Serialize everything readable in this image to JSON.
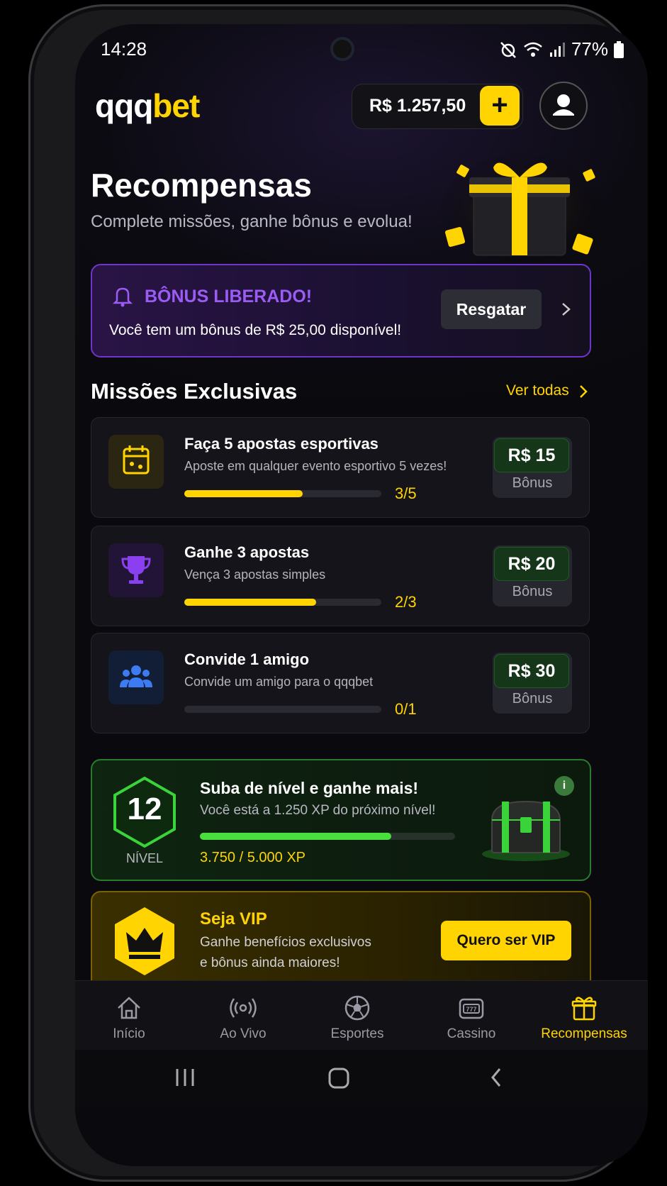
{
  "status": {
    "time": "14:28",
    "battery": "77%"
  },
  "header": {
    "logo_a": "qqq",
    "logo_b": "bet",
    "balance": "R$ 1.257,50",
    "add": "+"
  },
  "page": {
    "title": "Recompensas",
    "subtitle": "Complete missões, ganhe bônus e evolua!"
  },
  "bonus": {
    "title": "BÔNUS LIBERADO!",
    "text": "Você tem um bônus de R$ 25,00 disponível!",
    "button": "Resgatar"
  },
  "missions": {
    "title": "Missões Exclusivas",
    "see_all": "Ver todas",
    "items": [
      {
        "title": "Faça 5 apostas esportivas",
        "desc": "Aposte em qualquer evento esportivo 5 vezes!",
        "progress": "3/5",
        "fraction": 0.6,
        "reward": "R$ 15",
        "reward_label": "Bônus"
      },
      {
        "title": "Ganhe 3 apostas",
        "desc": "Vença 3 apostas simples",
        "progress": "2/3",
        "fraction": 0.67,
        "reward": "R$ 20",
        "reward_label": "Bônus"
      },
      {
        "title": "Convide 1 amigo",
        "desc": "Convide um amigo para o qqqbet",
        "progress": "0/1",
        "fraction": 0,
        "reward": "R$ 30",
        "reward_label": "Bônus"
      }
    ]
  },
  "level": {
    "number": "12",
    "label": "NÍVEL",
    "title": "Suba de nível e ganhe mais!",
    "desc": "Você está a 1.250 XP do próximo nível!",
    "xp": "3.750 / 5.000 XP",
    "fraction": 0.75,
    "info": "i"
  },
  "vip": {
    "title": "Seja VIP",
    "desc1": "Ganhe benefícios exclusivos",
    "desc2": "e bônus ainda maiores!",
    "button": "Quero ser VIP"
  },
  "nav": [
    {
      "label": "Início",
      "icon": "home-icon"
    },
    {
      "label": "Ao Vivo",
      "icon": "live-icon"
    },
    {
      "label": "Esportes",
      "icon": "soccer-ball-icon"
    },
    {
      "label": "Cassino",
      "icon": "slot-machine-icon"
    },
    {
      "label": "Recompensas",
      "icon": "gift-icon",
      "active": true
    }
  ],
  "colors": {
    "accent": "#ffd400",
    "purple": "#9b5cf5",
    "green": "#49e03f"
  }
}
